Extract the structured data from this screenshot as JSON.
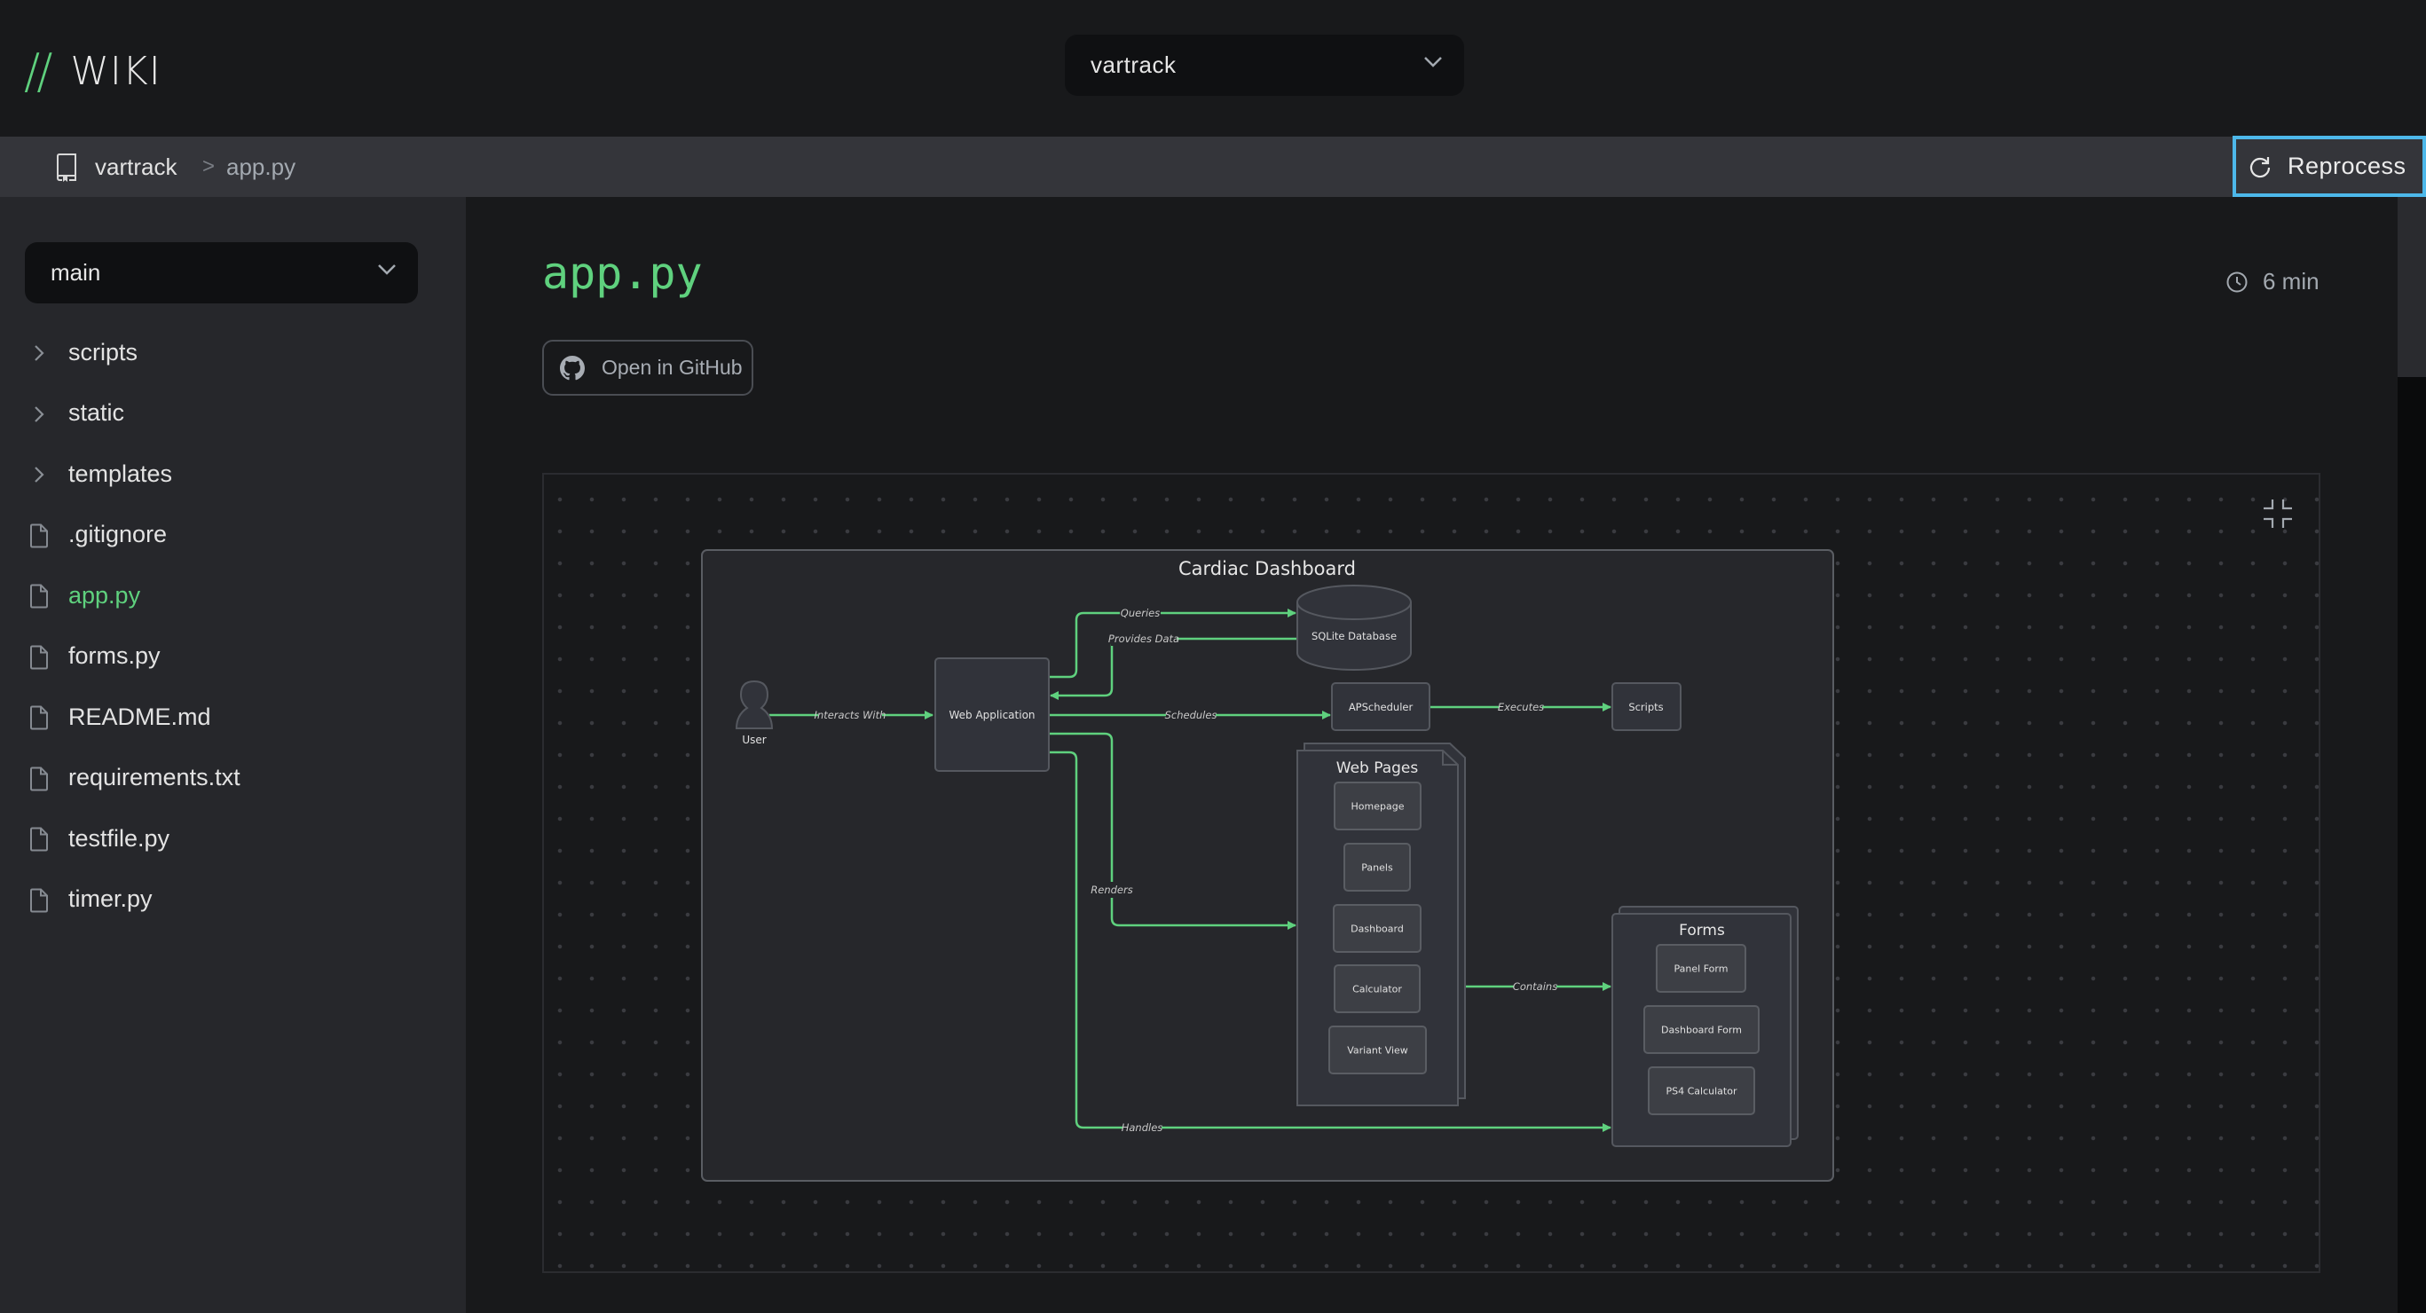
{
  "app": {
    "logo_mark": "//",
    "logo_text": "WIKI"
  },
  "repo_selector": {
    "value": "vartrack",
    "icon": "chevron-down-icon"
  },
  "breadcrumb": {
    "icon": "book-icon",
    "repo": "vartrack",
    "separator": ">",
    "file": "app.py"
  },
  "reprocess_button": {
    "icon": "refresh-icon",
    "label": "Reprocess"
  },
  "sidebar": {
    "branch_selector": {
      "value": "main",
      "icon": "chevron-down-icon"
    },
    "items": [
      {
        "label": "scripts",
        "type": "folder",
        "icon": "chevron-right-icon",
        "active": false
      },
      {
        "label": "static",
        "type": "folder",
        "icon": "chevron-right-icon",
        "active": false
      },
      {
        "label": "templates",
        "type": "folder",
        "icon": "chevron-right-icon",
        "active": false
      },
      {
        "label": ".gitignore",
        "type": "file",
        "icon": "file-icon",
        "active": false
      },
      {
        "label": "app.py",
        "type": "file",
        "icon": "file-icon",
        "active": true
      },
      {
        "label": "forms.py",
        "type": "file",
        "icon": "file-icon",
        "active": false
      },
      {
        "label": "README.md",
        "type": "file",
        "icon": "file-icon",
        "active": false
      },
      {
        "label": "requirements.txt",
        "type": "file",
        "icon": "file-icon",
        "active": false
      },
      {
        "label": "testfile.py",
        "type": "file",
        "icon": "file-icon",
        "active": false
      },
      {
        "label": "timer.py",
        "type": "file",
        "icon": "file-icon",
        "active": false
      }
    ]
  },
  "page": {
    "title": "app.py",
    "read_time": "6 min",
    "read_time_icon": "clock-icon",
    "github_button": {
      "label": "Open in GitHub",
      "icon": "github-icon"
    }
  },
  "diagram": {
    "collapse_icon": "collapse-icon",
    "title": "Cardiac Dashboard",
    "nodes": {
      "user": "User",
      "web_app": "Web Application",
      "database": "SQLite Database",
      "scheduler": "APScheduler",
      "scripts": "Scripts",
      "web_pages": {
        "title": "Web Pages",
        "items": [
          "Homepage",
          "Panels",
          "Dashboard",
          "Calculator",
          "Variant View"
        ]
      },
      "forms": {
        "title": "Forms",
        "items": [
          "Panel Form",
          "Dashboard Form",
          "PS4 Calculator"
        ]
      }
    },
    "edges": {
      "interacts": "Interacts With",
      "queries": "Queries",
      "provides": "Provides Data",
      "schedules": "Schedules",
      "executes": "Executes",
      "renders": "Renders",
      "contains": "Contains",
      "handles": "Handles"
    },
    "colors": {
      "edge": "#5fd17e",
      "node_fill": "#31333a",
      "node_stroke": "#55585f",
      "inner_fill": "#3d3f45",
      "frame_fill": "#26272b"
    }
  },
  "colors": {
    "accent": "#5fd17e",
    "focus_ring": "#4db8ea"
  }
}
